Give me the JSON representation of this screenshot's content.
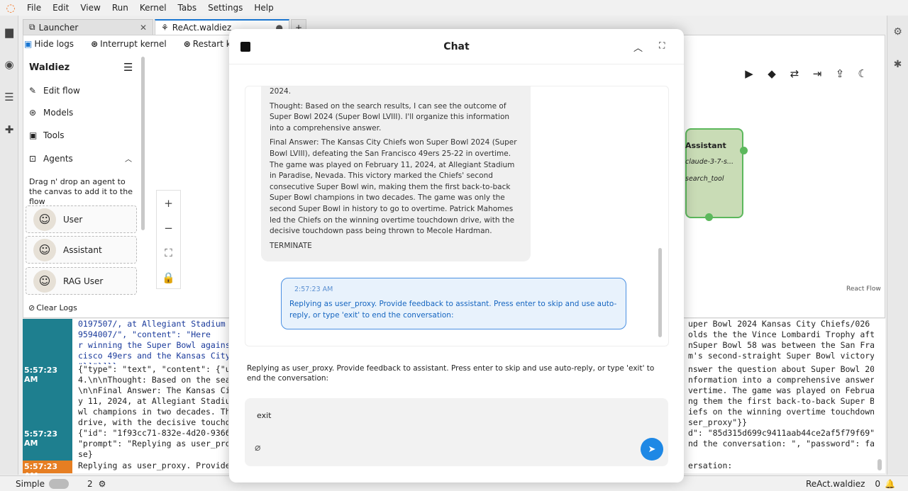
{
  "menu": [
    "File",
    "Edit",
    "View",
    "Run",
    "Kernel",
    "Tabs",
    "Settings",
    "Help"
  ],
  "tabs": [
    {
      "label": "Launcher"
    },
    {
      "label": "ReAct.waldiez"
    }
  ],
  "toolbar": {
    "hide_logs": "Hide logs",
    "interrupt": "Interrupt kernel",
    "restart": "Restart kernel"
  },
  "sidebar": {
    "title": "Waldiez",
    "items": [
      "Edit flow",
      "Models",
      "Tools",
      "Agents"
    ],
    "hint": "Drag n' drop an agent to the canvas to add it to the flow",
    "agents": [
      "User",
      "Assistant",
      "RAG User"
    ],
    "clear_logs": "Clear Logs"
  },
  "node": {
    "title": "Assistant",
    "model": "claude-3-7-s...",
    "tool": "search_tool"
  },
  "react_flow_label": "React Flow",
  "chat": {
    "title": "Chat",
    "assistant_message": {
      "top": "2024.",
      "thought": "Thought: Based on the search results, I can see the outcome of Super Bowl 2024 (Super Bowl LVIII). I'll organize this information into a comprehensive answer.",
      "final": "Final Answer: The Kansas City Chiefs won Super Bowl 2024 (Super Bowl LVIII), defeating the San Francisco 49ers 25-22 in overtime. The game was played on February 11, 2024, at Allegiant Stadium in Paradise, Nevada. This victory marked the Chiefs' second consecutive Super Bowl win, making them the first back-to-back Super Bowl champions in two decades. The game was only the second Super Bowl in history to go to overtime. Patrick Mahomes led the Chiefs on the winning overtime touchdown drive, with the decisive touchdown pass being thrown to Mecole Hardman.",
      "terminate": "TERMINATE"
    },
    "user_message": {
      "time": "2:57:23 AM",
      "text": "Replying as user_proxy. Provide feedback to assistant. Press enter to skip and use auto-reply, or type 'exit' to end the conversation:"
    },
    "prompt": "Replying as user_proxy. Provide feedback to assistant. Press enter to skip and use auto-reply, or type 'exit' to end the conversation:",
    "input_value": "exit"
  },
  "logs": [
    {
      "time": "",
      "left": "0197507/, at Allegiant Stadium\n9594007/\", \"content\": \"Here\nr winning the Super Bowl against\ncisco 49ers and the Kansas City\n\"}]\"}]}}",
      "right": "uper Bowl 2024 Kansas City Chiefs/026\nolds the the Vince Lombardi Trophy afte\nnSuper Bowl 58 was between the San Fran\nm's second-straight Super Bowl victory."
    },
    {
      "time": "5:57:23 AM",
      "left": "{\"type\": \"text\", \"content\": {\"u\n4.\\n\\nThought: Based on the sear\n\\n\\nFinal Answer: The Kansas Cit\ny 11, 2024, at Allegiant Stadiu\nwl champions in two decades. Th\ndrive, with the decisive touchdo",
      "right": "nswer the question about Super Bowl 202\nnformation into a comprehensive answer.\nvertime. The game was played on Februar\nng them the first back-to-back Super Bo\niefs on the winning overtime touchdown\nser_proxy\"}}"
    },
    {
      "time": "5:57:23 AM",
      "left": "{\"id\": \"1f93cc71-832e-4d20-9366-\n\"prompt\": \"Replying as user_prox\nse}",
      "right": "d\": \"85d315d699c9411aab44ce2af5f79f69\",\nnd the conversation: \", \"password\": fal\n"
    },
    {
      "time": "5:57:23 AM",
      "left": "Replying as user_proxy. Provide",
      "right": "ersation:"
    }
  ],
  "status": {
    "mode": "Simple",
    "count": "2",
    "filename": "ReAct.waldiez",
    "right_count": "0"
  }
}
